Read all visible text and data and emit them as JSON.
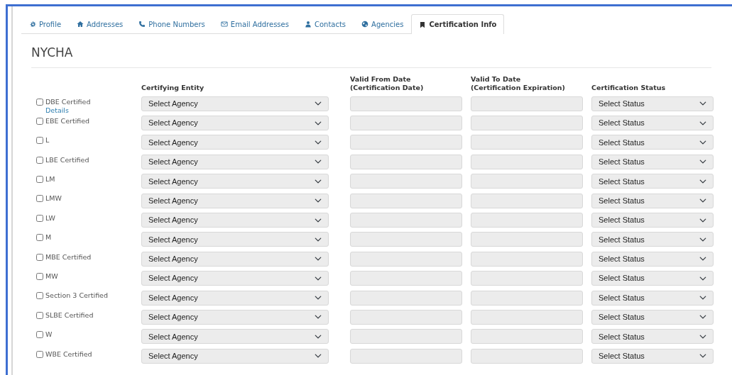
{
  "tabs": [
    {
      "label": "Profile",
      "kind": "gear",
      "selected": false
    },
    {
      "label": "Addresses",
      "kind": "house",
      "selected": false
    },
    {
      "label": "Phone Numbers",
      "kind": "phone",
      "selected": false
    },
    {
      "label": "Email Addresses",
      "kind": "envelope",
      "selected": false
    },
    {
      "label": "Contacts",
      "kind": "person",
      "selected": false
    },
    {
      "label": "Agencies",
      "kind": "globe",
      "selected": false
    },
    {
      "label": "Certification Info",
      "kind": "bookmark",
      "selected": true
    }
  ],
  "section_title": "NYCHA",
  "columns": [
    "Certifying Entity",
    "Valid From Date\n(Certification Date)",
    "Valid To Date\n(Certification Expiration)",
    "Certification Status"
  ],
  "rows": [
    {
      "label": "DBE Certified",
      "checked": false,
      "link": "Details",
      "agency": "Select Agency",
      "status": "Select Status"
    },
    {
      "label": "EBE Certified",
      "checked": false,
      "agency": "Select Agency",
      "status": "Select Status"
    },
    {
      "label": "L",
      "checked": false,
      "agency": "Select Agency",
      "status": "Select Status"
    },
    {
      "label": "LBE Certified",
      "checked": false,
      "agency": "Select Agency",
      "status": "Select Status"
    },
    {
      "label": "LM",
      "checked": false,
      "agency": "Select Agency",
      "status": "Select Status"
    },
    {
      "label": "LMW",
      "checked": false,
      "agency": "Select Agency",
      "status": "Select Status"
    },
    {
      "label": "LW",
      "checked": false,
      "agency": "Select Agency",
      "status": "Select Status"
    },
    {
      "label": "M",
      "checked": false,
      "agency": "Select Agency",
      "status": "Select Status"
    },
    {
      "label": "MBE Certified",
      "checked": false,
      "agency": "Select Agency",
      "status": "Select Status"
    },
    {
      "label": "MW",
      "checked": false,
      "agency": "Select Agency",
      "status": "Select Status"
    },
    {
      "label": "Section 3 Certified",
      "checked": false,
      "agency": "Select Agency",
      "status": "Select Status"
    },
    {
      "label": "SLBE Certified",
      "checked": false,
      "agency": "Select Agency",
      "status": "Select Status"
    },
    {
      "label": "W",
      "checked": false,
      "agency": "Select Agency",
      "status": "Select Status"
    },
    {
      "label": "WBE Certified",
      "checked": false,
      "agency": "Select Agency",
      "status": "Select Status"
    }
  ]
}
